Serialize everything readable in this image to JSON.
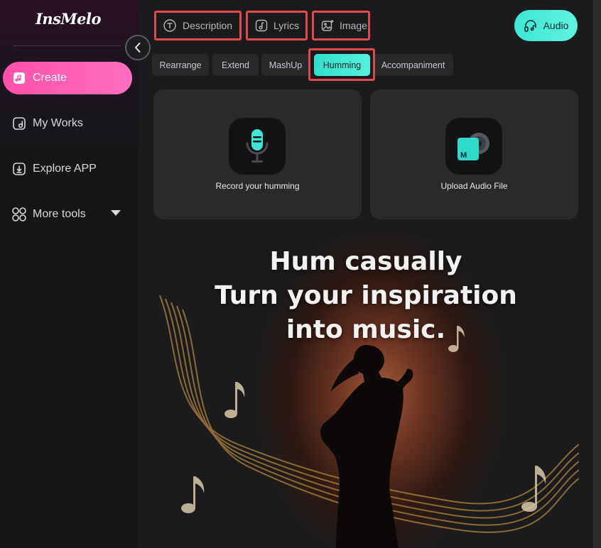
{
  "sidebar": {
    "logo": "InsMelo",
    "items": [
      {
        "label": "Create",
        "icon": "music-note-square-icon",
        "active": true
      },
      {
        "label": "My Works",
        "icon": "music-file-icon",
        "active": false
      },
      {
        "label": "Explore APP",
        "icon": "download-icon",
        "active": false
      },
      {
        "label": "More tools",
        "icon": "grid-icon",
        "active": false
      }
    ]
  },
  "modes": {
    "tabs": [
      {
        "label": "Description",
        "icon": "text-t-icon"
      },
      {
        "label": "Lyrics",
        "icon": "music-note-icon"
      },
      {
        "label": "Image",
        "icon": "image-sparkle-icon"
      }
    ],
    "audio_button": "Audio"
  },
  "subtabs": [
    {
      "label": "Rearrange",
      "active": false
    },
    {
      "label": "Extend",
      "active": false
    },
    {
      "label": "MashUp",
      "active": false
    },
    {
      "label": "Humming",
      "active": true
    },
    {
      "label": "Accompaniment",
      "active": false
    }
  ],
  "cards": {
    "record": "Record your humming",
    "upload": "Upload Audio File"
  },
  "banner": {
    "line1": "Hum casually",
    "line2": "Turn your inspiration",
    "line3": "into music."
  },
  "colors": {
    "accent_pink": "#ff4fa8",
    "accent_teal": "#3ee7d4",
    "highlight_red": "#e04a4a"
  }
}
